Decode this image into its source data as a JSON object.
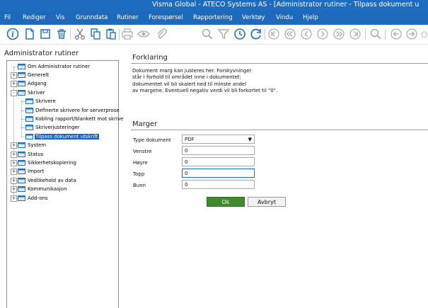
{
  "window": {
    "title": "Visma Global - ATECO Systems AS - [Administrator rutiner - Tilpass dokument u"
  },
  "menu": [
    "Fil",
    "Rediger",
    "Vis",
    "Grunndata",
    "Rutiner",
    "Forespørsel",
    "Rapportering",
    "Verktøy",
    "Vindu",
    "Hjelp"
  ],
  "toolbar": {
    "icons": [
      "info-icon",
      "new-document-icon",
      "save-icon",
      "delete-icon",
      "cut-icon",
      "copy-icon",
      "paste-icon",
      "print-icon",
      "preview-icon",
      "attach-icon",
      "search-icon",
      "filter-icon",
      "history-icon",
      "refresh-icon",
      "first-record-icon",
      "previous-page-icon",
      "previous-record-icon",
      "next-record-icon",
      "next-page-icon",
      "last-record-icon",
      "zoom-icon",
      "back-icon",
      "forward-icon",
      "home-icon"
    ]
  },
  "left_panel": {
    "title": "Administrator rutiner",
    "tree": [
      {
        "label": "Om Administrator rutiner",
        "level": 0,
        "expander": ""
      },
      {
        "label": "Generelt",
        "level": 0,
        "expander": "+"
      },
      {
        "label": "Adgang",
        "level": 0,
        "expander": "+"
      },
      {
        "label": "Skriver",
        "level": 0,
        "expander": "-"
      },
      {
        "label": "Skrivere",
        "level": 1,
        "expander": ""
      },
      {
        "label": "Definerte skrivere for serverprose",
        "level": 1,
        "expander": ""
      },
      {
        "label": "Kobling rapport/blankett mot skrive",
        "level": 1,
        "expander": ""
      },
      {
        "label": "Skriverjusteringer",
        "level": 1,
        "expander": ""
      },
      {
        "label": "Tilpass dokument utskrift",
        "level": 1,
        "expander": "",
        "selected": true
      },
      {
        "label": "System",
        "level": 0,
        "expander": "+"
      },
      {
        "label": "Status",
        "level": 0,
        "expander": "+"
      },
      {
        "label": "Sikkerhetskopiering",
        "level": 0,
        "expander": "+"
      },
      {
        "label": "Import",
        "level": 0,
        "expander": "+"
      },
      {
        "label": "Vedlikehold av data",
        "level": 0,
        "expander": "+"
      },
      {
        "label": "Kommunikasjon",
        "level": 0,
        "expander": "+"
      },
      {
        "label": "Add-ons",
        "level": 0,
        "expander": "+"
      }
    ]
  },
  "explanation": {
    "title": "Forklaring",
    "lines": [
      "Dokument marg kan justeres her. Forskyvninger",
      "står i forhold til området inne i dokumentet;",
      "dokumentet vil bli skalert ned til minste andel",
      "av margene. Eventuell negativ verdi vil bli forkortet til \"0\"."
    ]
  },
  "margins": {
    "title": "Marger",
    "type_label": "Type dokument",
    "type_value": "PDF",
    "left_label": "Venstre",
    "left_value": "0",
    "right_label": "Høyre",
    "right_value": "0",
    "top_label": "Topp",
    "top_value": "0",
    "bottom_label": "Bunn",
    "bottom_value": "0"
  },
  "buttons": {
    "ok": "Ok",
    "cancel": "Avbryt"
  },
  "colors": {
    "titlebar": "#1e6cc0",
    "selection": "#1a62c9",
    "ok_button": "#3f8a2d",
    "icon_blue": "#1a73c9"
  }
}
